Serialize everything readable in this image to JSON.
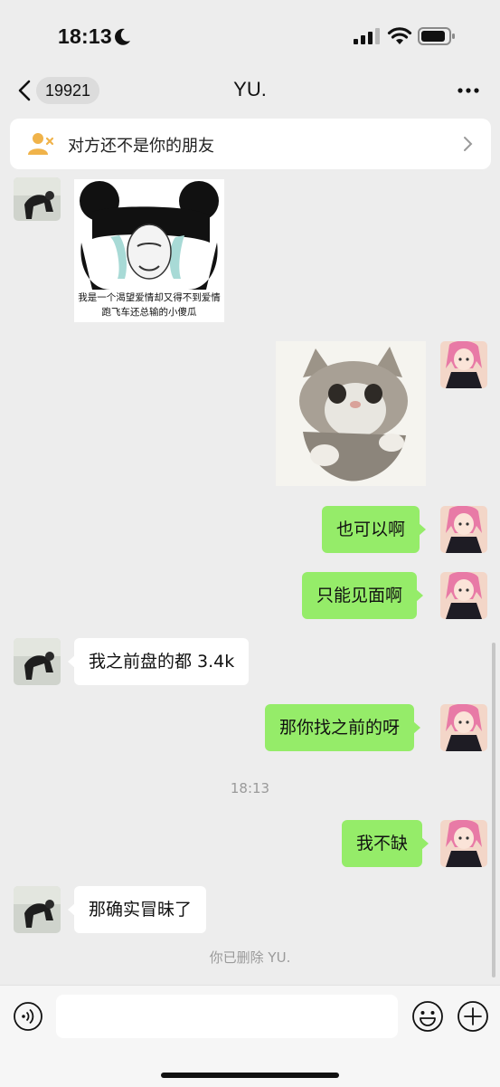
{
  "status_bar": {
    "time": "18:13",
    "battery_icon": "battery-icon",
    "wifi_icon": "wifi-icon",
    "signal_icon": "signal-icon",
    "moon_icon": "moon-icon"
  },
  "nav": {
    "back_badge": "19921",
    "title": "YU.",
    "more_icon": "more-icon"
  },
  "banner": {
    "text": "对方还不是你的朋友",
    "icon": "add-friend-icon"
  },
  "colors": {
    "my_bubble": "#95ec69",
    "their_bubble": "#ffffff",
    "background": "#ededed",
    "system_text": "#9a9a9a"
  },
  "messages": {
    "m1": {
      "sender": "them",
      "type": "sticker",
      "caption_line1": "我是一个渴望爱情却又得不到爱情",
      "caption_line2": "跑飞车还总输的小傻瓜"
    },
    "m2": {
      "sender": "me",
      "type": "sticker"
    },
    "m3": {
      "sender": "me",
      "text": "也可以啊"
    },
    "m4": {
      "sender": "me",
      "text": "只能见面啊"
    },
    "m5": {
      "sender": "them",
      "text": "我之前盘的都 3.4k"
    },
    "m6": {
      "sender": "me",
      "text": "那你找之前的呀"
    },
    "m7": {
      "sender": "me",
      "text": "我不缺"
    },
    "m8": {
      "sender": "them",
      "text": "那确实冒昧了"
    }
  },
  "timestamp": "18:13",
  "system_message": "你已删除 YU.",
  "input_bar": {
    "placeholder": "",
    "voice_icon": "voice-icon",
    "emoji_icon": "emoji-icon",
    "plus_icon": "plus-icon"
  }
}
